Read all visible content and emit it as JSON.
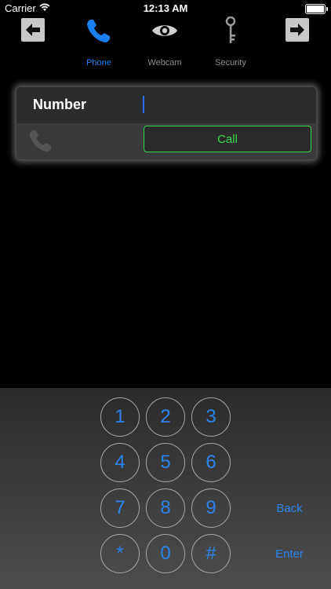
{
  "status_bar": {
    "carrier": "Carrier",
    "time": "12:13 AM"
  },
  "toolbar": {
    "tabs": [
      {
        "label": "Phone",
        "icon": "phone-icon",
        "active": true
      },
      {
        "label": "Webcam",
        "icon": "eye-icon",
        "active": false
      },
      {
        "label": "Security",
        "icon": "key-icon",
        "active": false
      }
    ],
    "left_icon": "arrow-left-icon",
    "right_icon": "arrow-right-icon"
  },
  "form": {
    "number_label": "Number",
    "number_value": "",
    "call_label": "Call"
  },
  "keypad": {
    "keys": [
      "1",
      "2",
      "3",
      "4",
      "5",
      "6",
      "7",
      "8",
      "9",
      "*",
      "0",
      "#"
    ],
    "back_label": "Back",
    "enter_label": "Enter"
  },
  "colors": {
    "accent": "#1a7ff0",
    "call_green": "#3ad94a",
    "keypad_digit": "#2a84f0"
  }
}
